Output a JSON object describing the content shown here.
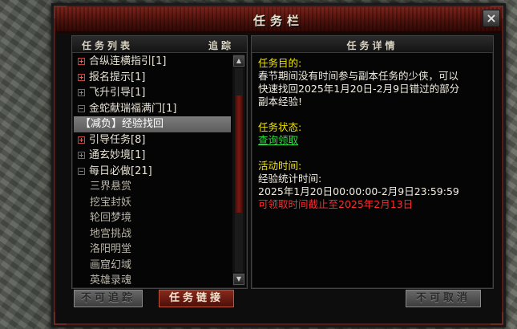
{
  "window": {
    "title": "任务栏",
    "close_label": "×"
  },
  "left_panel": {
    "header_left": "任务列表",
    "header_right": "追踪",
    "items": [
      {
        "label": "合纵连横指引[1]",
        "type": "group",
        "expanded": false
      },
      {
        "label": "报名提示[1]",
        "type": "group",
        "expanded": false
      },
      {
        "label": "飞升引导[1]",
        "type": "group",
        "expanded": false
      },
      {
        "label": "金蛇献瑞福满门[1]",
        "type": "group",
        "expanded": true
      },
      {
        "label": "【减负】经验找回",
        "type": "child",
        "selected": true
      },
      {
        "label": "引导任务[8]",
        "type": "group",
        "expanded": false
      },
      {
        "label": "通玄妙境[1]",
        "type": "group",
        "expanded": false
      },
      {
        "label": "每日必做[21]",
        "type": "group",
        "expanded": true
      },
      {
        "label": "三界悬赏",
        "type": "child"
      },
      {
        "label": "挖宝封妖",
        "type": "child"
      },
      {
        "label": "轮回梦境",
        "type": "child"
      },
      {
        "label": "地宫挑战",
        "type": "child"
      },
      {
        "label": "洛阳明堂",
        "type": "child"
      },
      {
        "label": "画窟幻域",
        "type": "child"
      },
      {
        "label": "英雄录魂",
        "type": "child"
      }
    ]
  },
  "right_panel": {
    "header": "任务详情",
    "goal_title": "任务目的:",
    "goal_text": "春节期间没有时间参与副本任务的少侠，可以快速找回2025年1月20日-2月9日错过的部分副本经验!",
    "status_title": "任务状态:",
    "status_link": "查询领取",
    "activity_title": "活动时间:",
    "activity_line1": "经验统计时间:",
    "activity_line2": "2025年1月20日00:00:00-2月9日23:59:59",
    "activity_line3": "可领取时间截止至2025年2月13日"
  },
  "buttons": {
    "untrack": "不可追踪",
    "link": "任务链接",
    "cancel": "不可取消"
  },
  "colors": {
    "accent_red": "#7a231b",
    "yellow_text": "#f0e400",
    "green_link": "#29e03a",
    "red_text": "#ff2a2a"
  }
}
